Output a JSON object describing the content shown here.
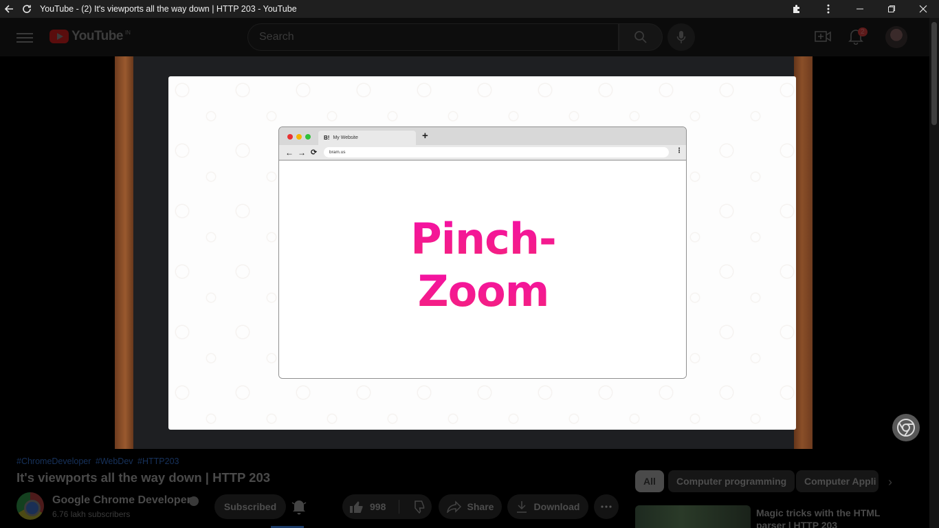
{
  "window": {
    "title": "YouTube - (2) It's viewports all the way down | HTTP 203 - YouTube"
  },
  "masthead": {
    "logo_text": "YouTube",
    "country_code": "IN",
    "search_placeholder": "Search",
    "notification_count": "2"
  },
  "video": {
    "mock_browser": {
      "tab_icon": "B!",
      "tab_label": "My Website",
      "new_tab": "+",
      "url": "bram.us",
      "content_line1": "Pinch-",
      "content_line2": "Zoom"
    }
  },
  "details": {
    "hashtags": [
      "#ChromeDeveloper",
      "#WebDev",
      "#HTTP203"
    ],
    "title": "It's viewports all the way down | HTTP 203",
    "channel_name": "Google Chrome Developers",
    "subscribers": "6.76 lakh subscribers",
    "subscribe_label": "Subscribed",
    "likes": "998",
    "share_label": "Share",
    "download_label": "Download"
  },
  "chips": [
    "All",
    "Computer programming",
    "Computer Appli"
  ],
  "recommendation": {
    "title": "Magic tricks with the HTML parser | HTTP 203"
  },
  "colors": {
    "pinch_zoom_gradient_top": "#f40fa9",
    "pinch_zoom_gradient_bottom": "#f4237a",
    "titlebar_bg": "#1f1f1f"
  }
}
